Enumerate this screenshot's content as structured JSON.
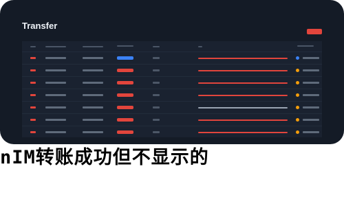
{
  "app": {
    "title": "Transfer"
  },
  "colors": {
    "background": "#141b26",
    "panel": "#1a2230",
    "accent_red": "#e2453c",
    "accent_blue": "#3b82f6",
    "status_orange": "#f59e0b"
  },
  "icons": {
    "status_dot": "status-dot-icon"
  },
  "table": {
    "rows": [
      {
        "badge": "blue",
        "hash": "red",
        "status": "blue"
      },
      {
        "badge": "red",
        "hash": "red",
        "status": "orange"
      },
      {
        "badge": "red",
        "hash": "red",
        "status": "orange"
      },
      {
        "badge": "red",
        "hash": "red",
        "status": "orange"
      },
      {
        "badge": "red",
        "hash": "gray",
        "status": "orange"
      },
      {
        "badge": "red",
        "hash": "red",
        "status": "orange"
      },
      {
        "badge": "red",
        "hash": "red",
        "status": "orange"
      }
    ]
  },
  "banner": {
    "text": "nIM转账成功但不显示的"
  }
}
